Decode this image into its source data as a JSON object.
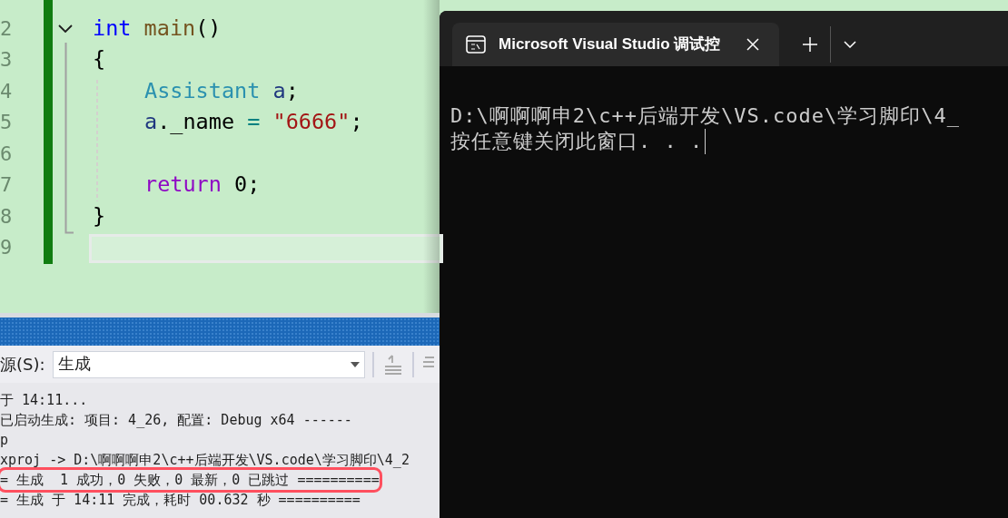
{
  "editor": {
    "lines": [
      {
        "number": "2",
        "foldable": true,
        "current": false,
        "indented": false,
        "tokens": [
          {
            "text": "int ",
            "kind": "keyword"
          },
          {
            "text": "main",
            "kind": "function"
          },
          {
            "text": "()",
            "kind": "punct"
          }
        ]
      },
      {
        "number": "3",
        "foldable": false,
        "current": false,
        "indented": false,
        "tokens": [
          {
            "text": "{",
            "kind": "punct"
          }
        ]
      },
      {
        "number": "4",
        "foldable": false,
        "current": false,
        "indented": true,
        "tokens": [
          {
            "text": "Assistant ",
            "kind": "type"
          },
          {
            "text": "a",
            "kind": "variable"
          },
          {
            "text": ";",
            "kind": "punct"
          }
        ]
      },
      {
        "number": "5",
        "foldable": false,
        "current": false,
        "indented": true,
        "tokens": [
          {
            "text": "a",
            "kind": "variable"
          },
          {
            "text": "._name ",
            "kind": "punct"
          },
          {
            "text": "= ",
            "kind": "operator"
          },
          {
            "text": "\"6666\"",
            "kind": "string"
          },
          {
            "text": ";",
            "kind": "punct"
          }
        ]
      },
      {
        "number": "6",
        "foldable": false,
        "current": false
      },
      {
        "number": "7",
        "foldable": false,
        "current": false,
        "indented": true,
        "tokens": [
          {
            "text": "return ",
            "kind": "control"
          },
          {
            "text": "0;",
            "kind": "punct"
          }
        ]
      },
      {
        "number": "8",
        "foldable": false,
        "current": false,
        "indented": false,
        "tokens": [
          {
            "text": "}",
            "kind": "punct"
          }
        ]
      },
      {
        "number": "9",
        "foldable": false,
        "current": true
      }
    ]
  },
  "output_panel": {
    "source_label": "源(S):",
    "source_value": "生成",
    "lines": [
      {
        "text": "于 14:11...",
        "highlighted": false
      },
      {
        "text": "已启动生成: 项目: 4_26, 配置: Debug x64 ------",
        "highlighted": false
      },
      {
        "text": "p",
        "highlighted": false
      },
      {
        "text": "xproj -> D:\\啊啊啊申2\\c++后端开发\\VS.code\\学习脚印\\4_2",
        "highlighted": false
      },
      {
        "text": "= 生成  1 成功，0 失败，0 最新，0 已跳过 ==========",
        "highlighted": true
      },
      {
        "text": "= 生成 于 14:11 完成，耗时 00.632 秒 ==========",
        "highlighted": false
      }
    ]
  },
  "console": {
    "tab_title": "Microsoft Visual Studio 调试控",
    "lines": [
      "D:\\啊啊啊申2\\c++后端开发\\VS.code\\学习脚印\\4_",
      "按任意键关闭此窗口. . ."
    ]
  }
}
